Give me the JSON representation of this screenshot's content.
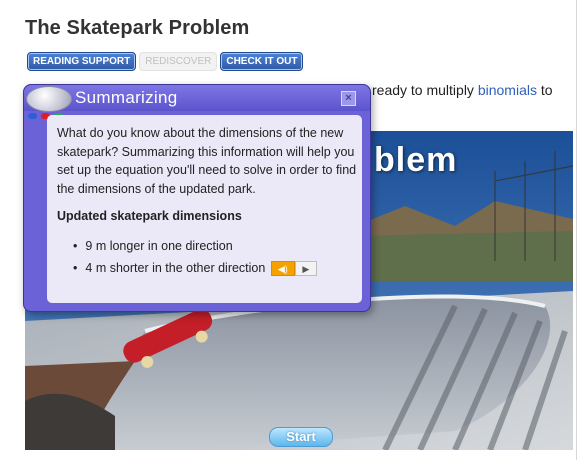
{
  "page": {
    "title": "The Skatepark Problem",
    "intro_text": "ready to multiply ",
    "intro_link": "binomials",
    "intro_suffix": " to"
  },
  "tabs": [
    {
      "label": "READING SUPPORT",
      "state": "active"
    },
    {
      "label": "REDISCOVER",
      "state": "disabled"
    },
    {
      "label": "CHECK IT OUT",
      "state": "active"
    }
  ],
  "scene": {
    "title_fragment": "blem",
    "start_label": "Start"
  },
  "panel": {
    "title": "Summarizing",
    "close_icon": "close-icon",
    "body": "What do you know about the dimensions of the new skatepark? Summarizing this information will help you set up the equation you'll need to solve in order to find the dimensions of the updated park.",
    "subheading": "Updated skatepark dimensions",
    "bullets": [
      "9 m longer in one direction",
      "4 m shorter in the other direction"
    ],
    "dot_colors": [
      "#2b5fd9",
      "#e02020",
      "#22b14c"
    ],
    "audio_icons": [
      "speaker-icon",
      "play-icon"
    ]
  },
  "colors": {
    "panel": "#6a62d6",
    "tab_active": "#2d5aa6",
    "link": "#2f5fba",
    "start_button": "#5db6ec"
  }
}
